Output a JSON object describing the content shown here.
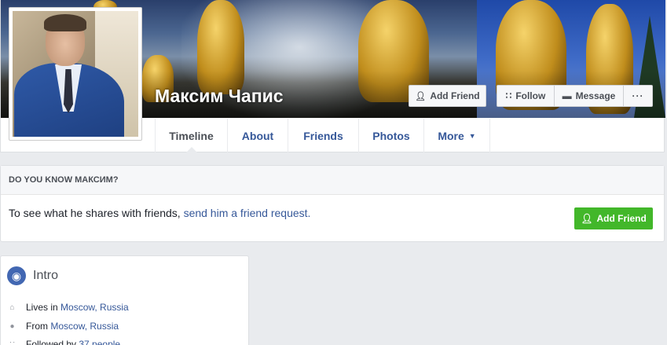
{
  "profile": {
    "name": "Максим Чапис"
  },
  "cover_actions": {
    "add_friend": "Add Friend",
    "follow": "Follow",
    "message": "Message",
    "more": "···"
  },
  "tabs": [
    {
      "label": "Timeline"
    },
    {
      "label": "About"
    },
    {
      "label": "Friends"
    },
    {
      "label": "Photos"
    },
    {
      "label": "More"
    }
  ],
  "know_box": {
    "heading": "DO YOU KNOW МАКСИМ?",
    "text": "To see what he shares with friends, ",
    "link": "send him a friend request.",
    "button": "Add Friend"
  },
  "intro": {
    "title": "Intro",
    "rows": [
      {
        "prefix": "Lives in ",
        "link": "Moscow, Russia"
      },
      {
        "prefix": "From ",
        "link": "Moscow, Russia"
      },
      {
        "prefix": "Followed by ",
        "link": "37 people"
      }
    ]
  },
  "colors": {
    "link": "#365899",
    "green_button": "#42b72a",
    "page_bg": "#e9ebee"
  }
}
